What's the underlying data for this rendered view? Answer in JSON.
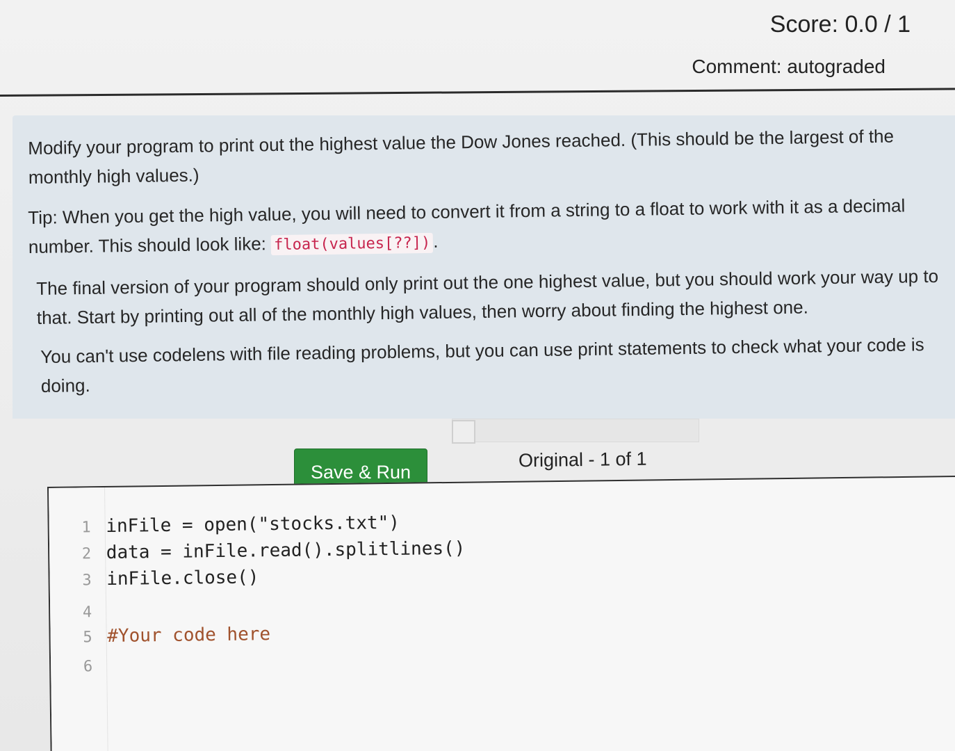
{
  "header": {
    "score": "Score: 0.0 / 1",
    "comment": "Comment: autograded"
  },
  "instructions": {
    "p1": "Modify your program to print out the highest value the Dow Jones reached. (This should be the largest of the monthly high values.)",
    "p2_before": "Tip: When you get the high value, you will need to convert it from a string to a float to work with it as a decimal number. This should look like: ",
    "p2_code": "float(values[??])",
    "p2_after": ".",
    "p3": "The final version of your program should only print out the one highest value, but you should work your way up to that. Start by printing out all of the monthly high values, then worry about finding the highest one.",
    "p4": "You can't use codelens with file reading problems, but you can use print statements to check what your code is doing."
  },
  "toolbar": {
    "save_run_label": "Save & Run",
    "version_label": "Original - 1 of 1"
  },
  "editor": {
    "lines": [
      {
        "num": "1",
        "text": "inFile = open(\"stocks.txt\")"
      },
      {
        "num": "2",
        "text": "data = inFile.read().splitlines()"
      },
      {
        "num": "3",
        "text": "inFile.close()"
      },
      {
        "num": "4",
        "text": ""
      },
      {
        "num": "5",
        "text": "#Your code here"
      },
      {
        "num": "6",
        "text": ""
      }
    ]
  }
}
